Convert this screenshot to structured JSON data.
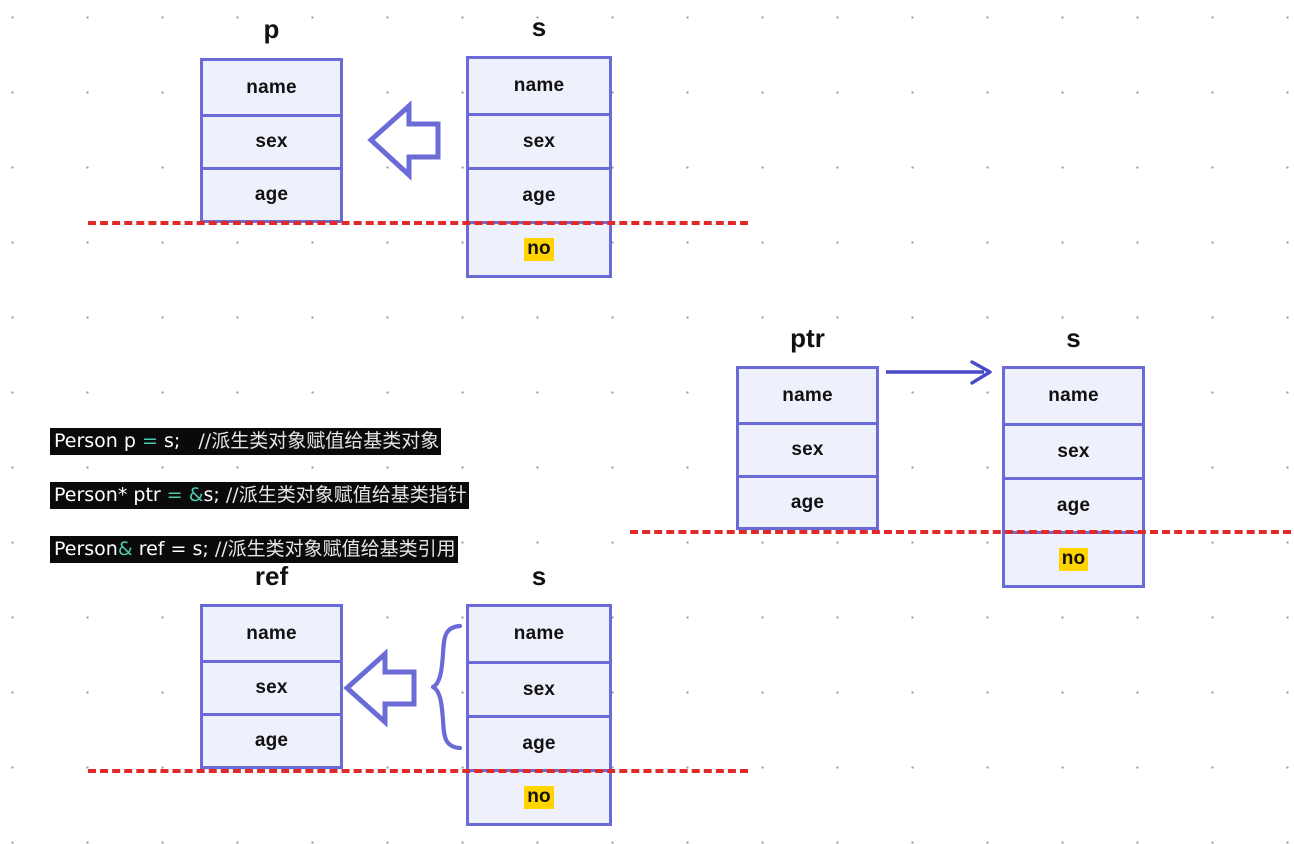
{
  "diagram": {
    "title": "C++ derived-to-base assignment: object, pointer, reference",
    "colors": {
      "box_border": "#6B6BD8",
      "box_fill": "#EEF0FC",
      "divider_red": "#E02A2A",
      "highlight_yellow": "#FFD400",
      "code_bg": "#0a0a0a",
      "code_text": "#ffffff",
      "code_operator": "#4EC9B0"
    },
    "groups": [
      {
        "id": "group-object",
        "left": {
          "label": "p",
          "fields": [
            "name",
            "sex",
            "age"
          ]
        },
        "right": {
          "label": "s",
          "fields": [
            "name",
            "sex",
            "age",
            "no"
          ],
          "highlighted_field": "no"
        },
        "connector": "hollow-left-arrow"
      },
      {
        "id": "group-pointer",
        "left": {
          "label": "ptr",
          "fields": [
            "name",
            "sex",
            "age"
          ]
        },
        "right": {
          "label": "s",
          "fields": [
            "name",
            "sex",
            "age",
            "no"
          ],
          "highlighted_field": "no"
        },
        "connector": "thin-right-arrow"
      },
      {
        "id": "group-reference",
        "left": {
          "label": "ref",
          "fields": [
            "name",
            "sex",
            "age"
          ]
        },
        "right": {
          "label": "s",
          "fields": [
            "name",
            "sex",
            "age",
            "no"
          ],
          "highlighted_field": "no"
        },
        "connector": "hollow-left-arrow-with-brace"
      }
    ],
    "code": {
      "lines": [
        {
          "decl": "Person p ",
          "op": "= ",
          "rhs": "s;",
          "gap": "   ",
          "comment": "//派生类对象赋值给基类对象"
        },
        {
          "decl": "Person* ptr ",
          "op": "= &",
          "rhs": "s;",
          "gap": " ",
          "comment": "//派生类对象赋值给基类指针"
        },
        {
          "decl": "Person",
          "op": "& ",
          "rhs": "ref = s;",
          "gap": " ",
          "comment": "//派生类对象赋值给基类引用"
        }
      ]
    }
  }
}
